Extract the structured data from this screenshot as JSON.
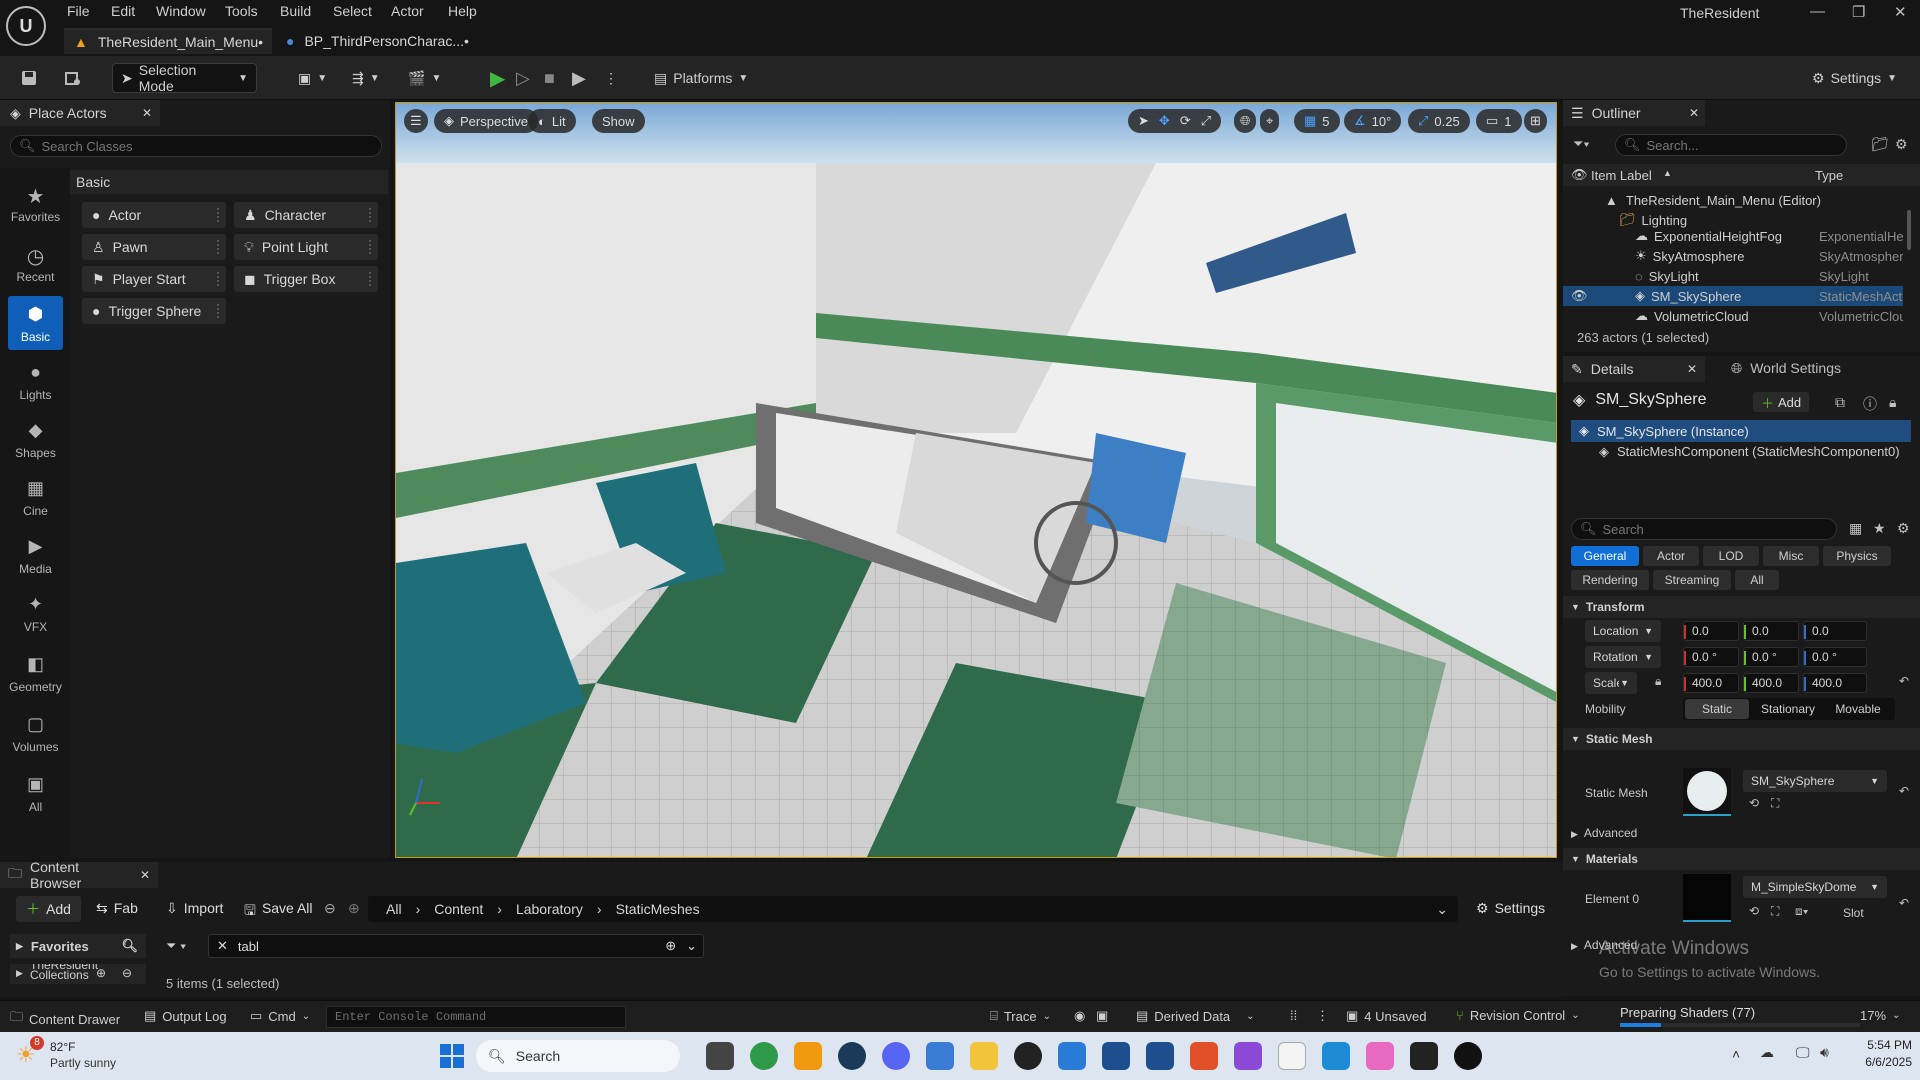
{
  "menubar": {
    "items": [
      "File",
      "Edit",
      "Window",
      "Tools",
      "Build",
      "Select",
      "Actor",
      "Help"
    ],
    "project_name": "TheResident",
    "tabs": [
      {
        "label": "TheResident_Main_Menu•"
      },
      {
        "label": "BP_ThirdPersonCharac...•"
      }
    ]
  },
  "toolbar": {
    "selection_mode": "Selection Mode",
    "platforms": "Platforms",
    "settings": "Settings"
  },
  "place_actors": {
    "title": "Place Actors",
    "search_placeholder": "Search Classes",
    "section": "Basic",
    "categories": [
      "Favorites",
      "Recent",
      "Basic",
      "Lights",
      "Shapes",
      "Cine",
      "Media",
      "VFX",
      "Geometry",
      "Volumes",
      "All"
    ],
    "items": [
      "Actor",
      "Character",
      "Pawn",
      "Point Light",
      "Player Start",
      "Trigger Box",
      "Trigger Sphere"
    ]
  },
  "viewport": {
    "perspective": "Perspective",
    "lit": "Lit",
    "show": "Show",
    "grid_value": "5",
    "angle_value": "10°",
    "scale_value": "0.25",
    "camera_value": "1"
  },
  "outliner": {
    "title": "Outliner",
    "search_placeholder": "Search...",
    "col_label": "Item Label",
    "col_type": "Type",
    "rows": [
      {
        "label": "TheResident_Main_Menu (Editor)",
        "type": ""
      },
      {
        "label": "Lighting",
        "type": ""
      },
      {
        "label": "ExponentialHeightFog",
        "type": "ExponentialHe"
      },
      {
        "label": "SkyAtmosphere",
        "type": "SkyAtmospher"
      },
      {
        "label": "SkyLight",
        "type": "SkyLight"
      },
      {
        "label": "SM_SkySphere",
        "type": "StaticMeshAct"
      },
      {
        "label": "VolumetricCloud",
        "type": "VolumetricClou"
      }
    ],
    "status": "263 actors (1 selected)"
  },
  "details": {
    "tab": "Details",
    "world_tab": "World Settings",
    "object_name": "SM_SkySphere",
    "add_label": "Add",
    "instance": "SM_SkySphere (Instance)",
    "component": "StaticMeshComponent (StaticMeshComponent0)",
    "search_placeholder": "Search",
    "filters_row1": [
      "General",
      "Actor",
      "LOD",
      "Misc",
      "Physics"
    ],
    "filters_row2": [
      "Rendering",
      "Streaming",
      "All"
    ],
    "transform_title": "Transform",
    "location_label": "Location",
    "rotation_label": "Rotation",
    "scale_label": "Scale",
    "location": [
      "0.0",
      "0.0",
      "0.0"
    ],
    "rotation": [
      "0.0 °",
      "0.0 °",
      "0.0 °"
    ],
    "scale": [
      "400.0",
      "400.0",
      "400.0"
    ],
    "mobility_label": "Mobility",
    "mobility_options": [
      "Static",
      "Stationary",
      "Movable"
    ],
    "static_mesh_title": "Static Mesh",
    "static_mesh_label": "Static Mesh",
    "static_mesh_value": "SM_SkySphere",
    "advanced": "Advanced",
    "materials_title": "Materials",
    "element0_label": "Element 0",
    "element0_value": "M_SimpleSkyDome",
    "slot_label": "Slot",
    "advanced2": "Advanced"
  },
  "watermark": {
    "line1": "Activate Windows",
    "line2": "Go to Settings to activate Windows."
  },
  "content_browser": {
    "title": "Content Browser",
    "add": "Add",
    "fab": "Fab",
    "import": "Import",
    "save_all": "Save All",
    "path": [
      "All",
      "Content",
      "Laboratory",
      "StaticMeshes"
    ],
    "settings": "Settings",
    "favorites": "Favorites",
    "collection_a": "TheResident",
    "collection_b": "Collections",
    "filter_text": "tabl",
    "items_status": "5 items (1 selected)"
  },
  "statusbar": {
    "content_drawer": "Content Drawer",
    "output_log": "Output Log",
    "cmd": "Cmd",
    "console_placeholder": "Enter Console Command",
    "trace": "Trace",
    "derived_data": "Derived Data",
    "unsaved": "4 Unsaved",
    "revision_control": "Revision Control",
    "shaders": "Preparing Shaders (77)",
    "shader_percent": "17%",
    "shader_progress": 0.17
  },
  "taskbar": {
    "weather_temp": "82°F",
    "weather_desc": "Partly sunny",
    "weather_badge": "8",
    "search": "Search",
    "time": "5:54 PM",
    "date": "6/6/2025"
  }
}
